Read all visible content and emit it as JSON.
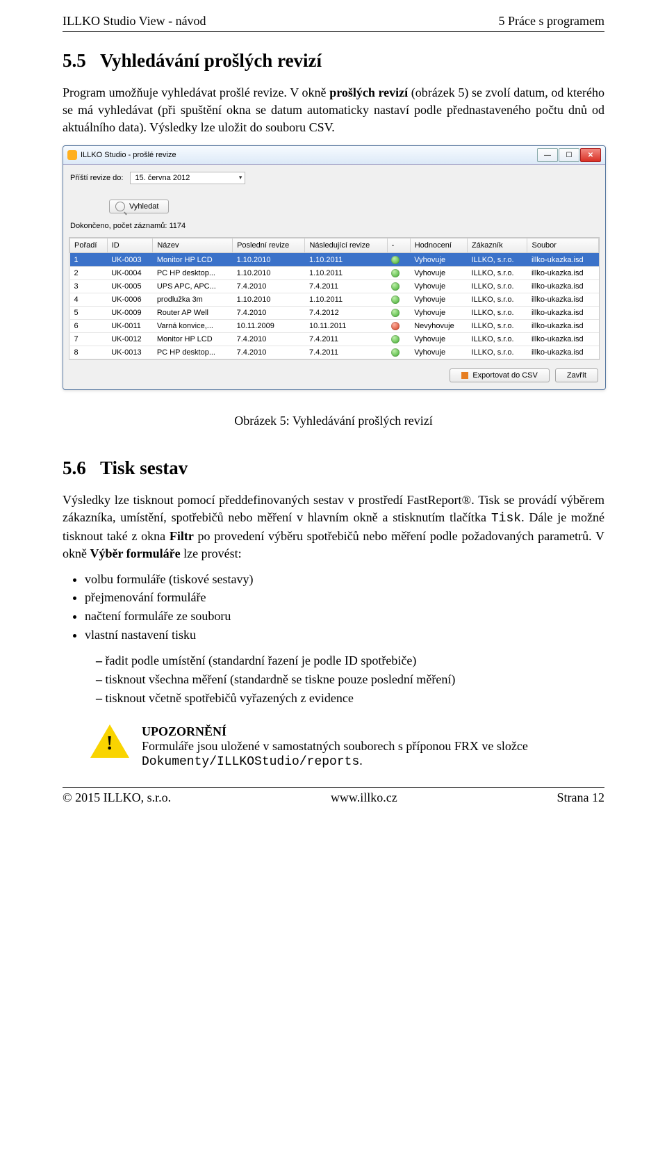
{
  "header": {
    "left": "ILLKO Studio View - návod",
    "right": "5   Práce s programem"
  },
  "sec55": {
    "num": "5.5",
    "title": "Vyhledávání prošlých revizí",
    "para": "Program umožňuje vyhledávat prošlé revize. V okně prošlých revizí (obrázek 5) se zvolí datum, od kterého se má vyhledávat (při spuštění okna se datum automaticky nastaví podle přednastaveného počtu dnů od aktuálního data). Výsledky lze uložit do souboru CSV."
  },
  "screenshot": {
    "window_title": "ILLKO Studio - prošlé revize",
    "label_next_rev": "Příští revize do:",
    "date_value": "15. června 2012",
    "search_label": "Vyhledat",
    "status_line": "Dokončeno, počet záznamů: 1174",
    "columns": [
      "Pořadí",
      "ID",
      "Název",
      "Poslední revize",
      "Následující revize",
      "-",
      "Hodnocení",
      "Zákazník",
      "Soubor"
    ],
    "rows": [
      {
        "sel": true,
        "c": [
          "1",
          "UK-0003",
          "Monitor HP LCD",
          "1.10.2010",
          "1.10.2011",
          "ok",
          "Vyhovuje",
          "ILLKO, s.r.o.",
          "illko-ukazka.isd"
        ]
      },
      {
        "sel": false,
        "c": [
          "2",
          "UK-0004",
          "PC HP desktop...",
          "1.10.2010",
          "1.10.2011",
          "ok",
          "Vyhovuje",
          "ILLKO, s.r.o.",
          "illko-ukazka.isd"
        ]
      },
      {
        "sel": false,
        "c": [
          "3",
          "UK-0005",
          "UPS APC, APC...",
          "7.4.2010",
          "7.4.2011",
          "ok",
          "Vyhovuje",
          "ILLKO, s.r.o.",
          "illko-ukazka.isd"
        ]
      },
      {
        "sel": false,
        "c": [
          "4",
          "UK-0006",
          "prodlužka 3m",
          "1.10.2010",
          "1.10.2011",
          "ok",
          "Vyhovuje",
          "ILLKO, s.r.o.",
          "illko-ukazka.isd"
        ]
      },
      {
        "sel": false,
        "c": [
          "5",
          "UK-0009",
          "Router AP Well",
          "7.4.2010",
          "7.4.2012",
          "ok",
          "Vyhovuje",
          "ILLKO, s.r.o.",
          "illko-ukazka.isd"
        ]
      },
      {
        "sel": false,
        "c": [
          "6",
          "UK-0011",
          "Varná konvice,...",
          "10.11.2009",
          "10.11.2011",
          "bad",
          "Nevyhovuje",
          "ILLKO, s.r.o.",
          "illko-ukazka.isd"
        ]
      },
      {
        "sel": false,
        "c": [
          "7",
          "UK-0012",
          "Monitor HP LCD",
          "7.4.2010",
          "7.4.2011",
          "ok",
          "Vyhovuje",
          "ILLKO, s.r.o.",
          "illko-ukazka.isd"
        ]
      },
      {
        "sel": false,
        "c": [
          "8",
          "UK-0013",
          "PC HP desktop...",
          "7.4.2010",
          "7.4.2011",
          "ok",
          "Vyhovuje",
          "ILLKO, s.r.o.",
          "illko-ukazka.isd"
        ]
      }
    ],
    "btn_export": "Exportovat do CSV",
    "btn_close": "Zavřít"
  },
  "caption5": "Obrázek 5: Vyhledávání prošlých revizí",
  "sec56": {
    "num": "5.6",
    "title": "Tisk sestav",
    "para": "Výsledky lze tisknout pomocí předdefinovaných sestav v prostředí FastReport®. Tisk se provádí výběrem zákazníka, umístění, spotřebičů nebo měření v hlavním okně a stisknutím tlačítka Tisk. Dále je možné tisknout také z okna Filtr po provedení výběru spotřebičů nebo měření podle požadovaných parametrů. V okně Výběr formuláře lze provést:",
    "bullets1": [
      "volbu formuláře (tiskové sestavy)",
      "přejmenování formuláře",
      "načtení formuláře ze souboru",
      "vlastní nastavení tisku"
    ],
    "bullets2": [
      "řadit podle umístění (standardní řazení je podle ID spotřebiče)",
      "tisknout všechna měření (standardně se tiskne pouze poslední měření)",
      "tisknout včetně spotřebičů vyřazených z evidence"
    ]
  },
  "warning": {
    "title": "UPOZORNĚNÍ",
    "body_a": "Formuláře jsou uložené v samostatných souborech s příponou FRX ve složce ",
    "body_b": "Dokumenty/ILLKOStudio/reports",
    "body_c": "."
  },
  "footer": {
    "left": "© 2015 ILLKO, s.r.o.",
    "center": "www.illko.cz",
    "right": "Strana 12"
  }
}
